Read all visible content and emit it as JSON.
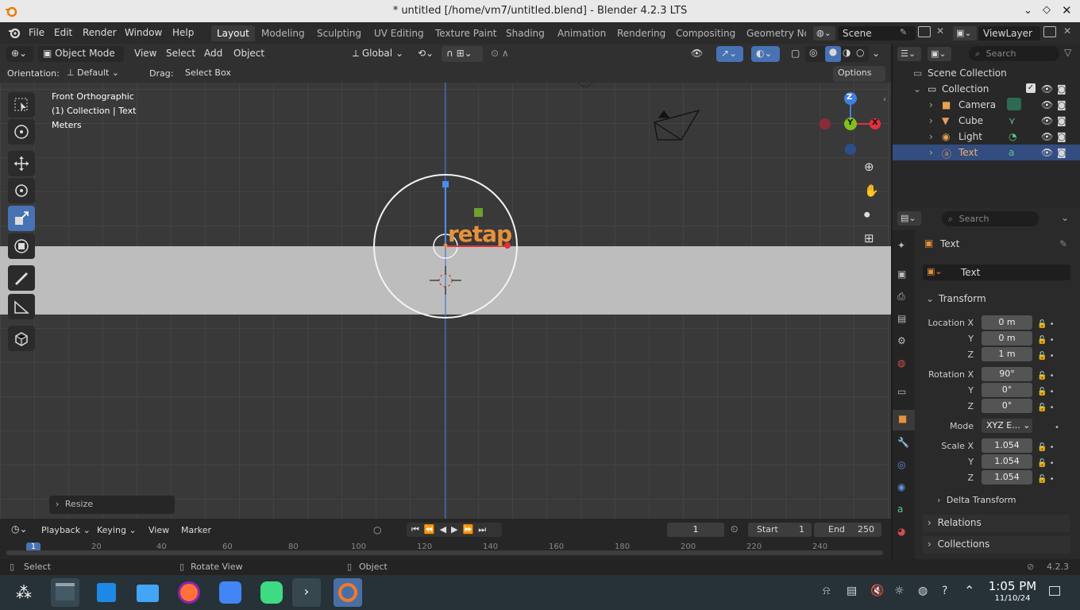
{
  "window": {
    "title": "* untitled [/home/vm7/untitled.blend] - Blender 4.2.3 LTS"
  },
  "menubar": {
    "items": [
      "File",
      "Edit",
      "Render",
      "Window",
      "Help"
    ],
    "workspaces": [
      "Layout",
      "Modeling",
      "Sculpting",
      "UV Editing",
      "Texture Paint",
      "Shading",
      "Animation",
      "Rendering",
      "Compositing",
      "Geometry Noc"
    ],
    "scene": "Scene",
    "view_layer": "ViewLayer"
  },
  "viewport_header": {
    "mode": "Object Mode",
    "menus": [
      "View",
      "Select",
      "Add",
      "Object"
    ],
    "transform_orientation": "Global"
  },
  "tool_header": {
    "orientation_label": "Orientation:",
    "orientation_value": "Default",
    "drag_label": "Drag:",
    "drag_value": "Select Box",
    "options": "Options"
  },
  "viewport": {
    "view_name": "Front Orthographic",
    "collection_info": "(1) Collection | Text",
    "units": "Meters",
    "text_object": "retap",
    "operator_panel": "Resize",
    "gizmo": {
      "z": "Z",
      "y": "Y",
      "x": "X"
    }
  },
  "timeline": {
    "menus": [
      "Playback",
      "Keying",
      "View",
      "Marker"
    ],
    "current_frame": "1",
    "start_label": "Start",
    "start": "1",
    "end_label": "End",
    "end": "250",
    "ruler": [
      "1",
      "20",
      "40",
      "60",
      "80",
      "100",
      "120",
      "140",
      "160",
      "180",
      "200",
      "220",
      "240"
    ]
  },
  "statusbar": {
    "select": "Select",
    "rotate": "Rotate View",
    "object": "Object",
    "version": "4.2.3"
  },
  "outliner": {
    "search_placeholder": "Search",
    "scene_collection": "Scene Collection",
    "collection": "Collection",
    "items": [
      {
        "name": "Camera"
      },
      {
        "name": "Cube"
      },
      {
        "name": "Light"
      },
      {
        "name": "Text",
        "selected": true
      }
    ]
  },
  "properties": {
    "search_placeholder": "Search",
    "object_header": "Text",
    "object_name": "Text",
    "panel_transform": "Transform",
    "location": {
      "label": "Location X",
      "x": "0 m",
      "y": "0 m",
      "z": "1 m"
    },
    "rotation": {
      "label": "Rotation X",
      "x": "90°",
      "y": "0°",
      "z": "0°"
    },
    "mode_label": "Mode",
    "mode_value": "XYZ E...",
    "scale": {
      "label": "Scale X",
      "x": "1.054",
      "y": "1.054",
      "z": "1.054"
    },
    "axis_y": "Y",
    "axis_z": "Z",
    "delta": "Delta Transform",
    "relations": "Relations",
    "collections": "Collections"
  },
  "taskbar": {
    "time": "1:05 PM",
    "date": "11/10/24"
  },
  "colors": {
    "accent": "#4772b3",
    "selected_row": "#334d80",
    "text_orange": "#e8913a",
    "gizmo_x": "#e0313d",
    "gizmo_y": "#80c020",
    "gizmo_z": "#3f7fe0"
  }
}
